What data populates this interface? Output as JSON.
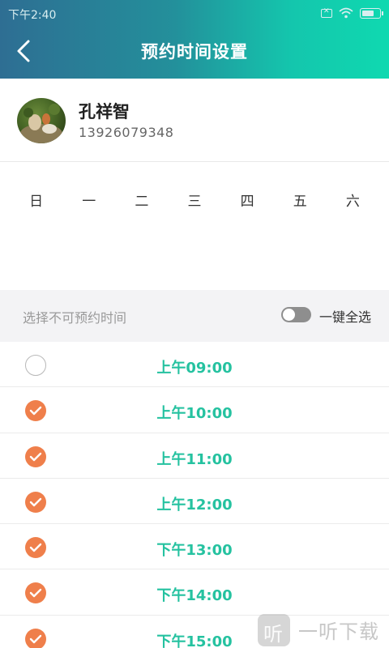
{
  "status": {
    "time": "下午2:40"
  },
  "header": {
    "title": "预约时间设置"
  },
  "profile": {
    "name": "孔祥智",
    "phone": "13926079348"
  },
  "weekdays": [
    "日",
    "一",
    "二",
    "三",
    "四",
    "五",
    "六"
  ],
  "selection": {
    "label": "选择不可预约时间",
    "select_all_label": "一键全选",
    "select_all_on": false
  },
  "colors": {
    "accent": "#25c2a0",
    "check": "#ef7f4b",
    "header_start": "#2e6e93",
    "header_end": "#0fd9b0"
  },
  "slots": [
    {
      "time": "上午09:00",
      "checked": false
    },
    {
      "time": "上午10:00",
      "checked": true
    },
    {
      "time": "上午11:00",
      "checked": true
    },
    {
      "time": "上午12:00",
      "checked": true
    },
    {
      "time": "下午13:00",
      "checked": true
    },
    {
      "time": "下午14:00",
      "checked": true
    },
    {
      "time": "下午15:00",
      "checked": true
    }
  ],
  "watermark": {
    "text": "一听下载"
  }
}
